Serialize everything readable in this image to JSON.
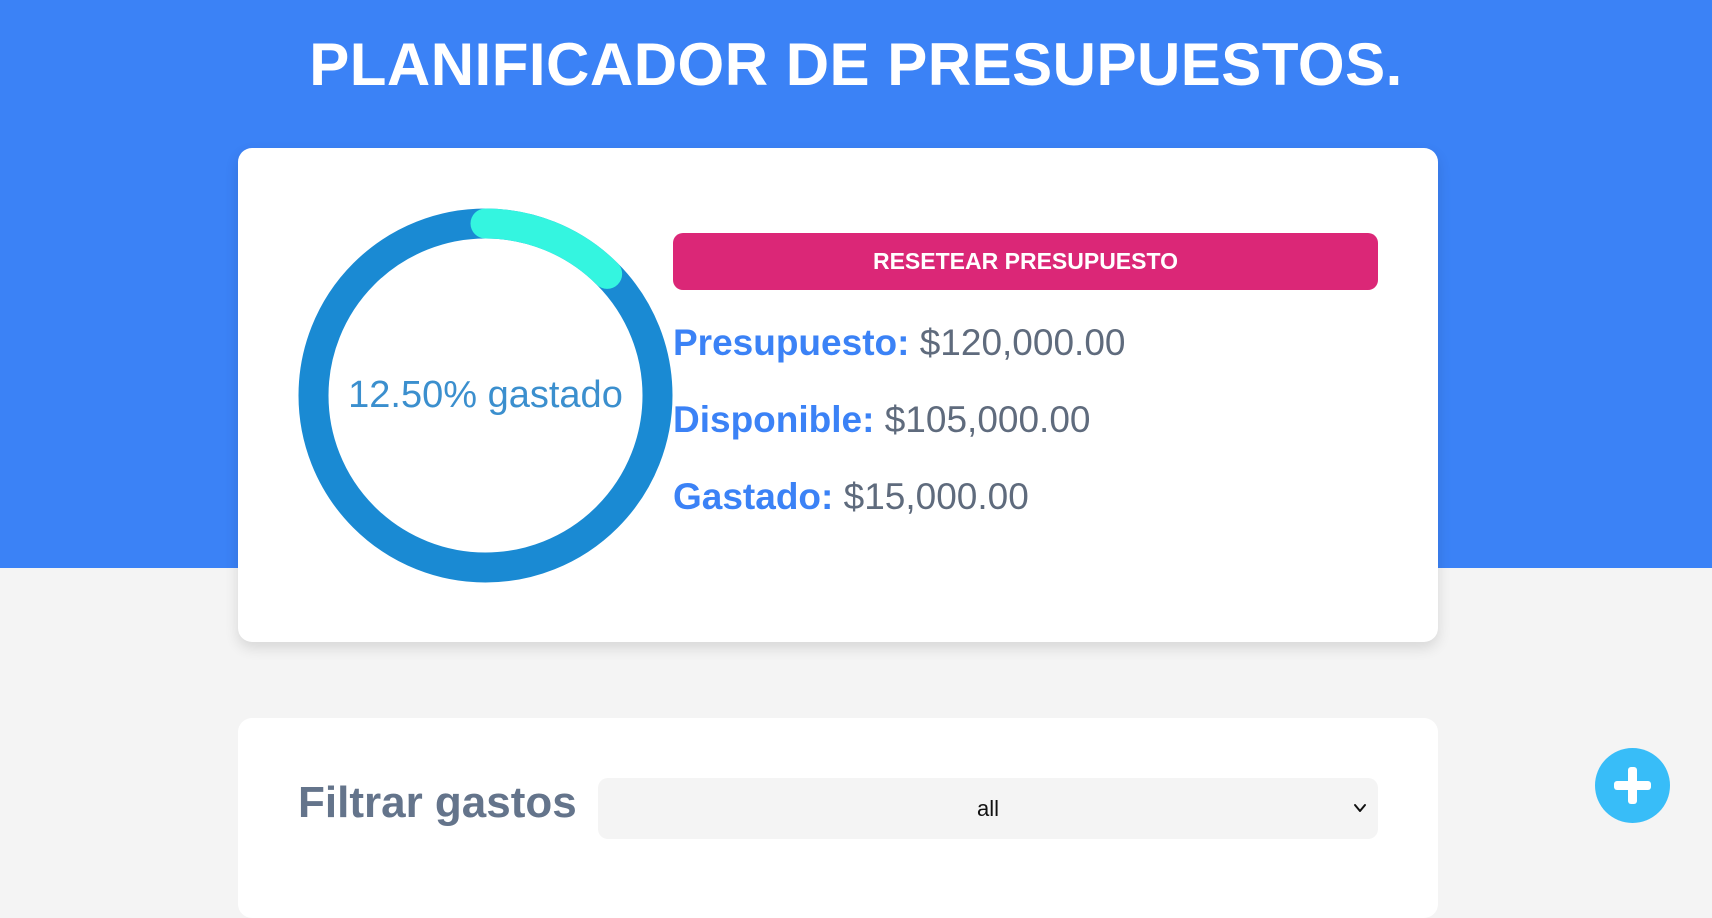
{
  "header": {
    "title": "PLANIFICADOR DE PRESUPUESTOS."
  },
  "budget": {
    "progress": {
      "percent_spent": 12.5,
      "label": "12.50% gastado",
      "track_color": "#1a8ad3",
      "fill_color": "#34f5e0"
    },
    "reset_button_label": "RESETEAR PRESUPUESTO",
    "stats": [
      {
        "label": "Presupuesto:",
        "value": "$120,000.00"
      },
      {
        "label": "Disponible:",
        "value": "$105,000.00"
      },
      {
        "label": "Gastado:",
        "value": "$15,000.00"
      }
    ]
  },
  "filter": {
    "label": "Filtrar gastos",
    "selected": "all",
    "chevron_icon": "chevron-down-icon"
  },
  "add_button": {
    "icon": "plus-icon",
    "color": "#38bdf8"
  },
  "colors": {
    "header_bg": "#3b82f6",
    "accent_pink": "#db2777",
    "stat_label": "#3b82f6"
  }
}
